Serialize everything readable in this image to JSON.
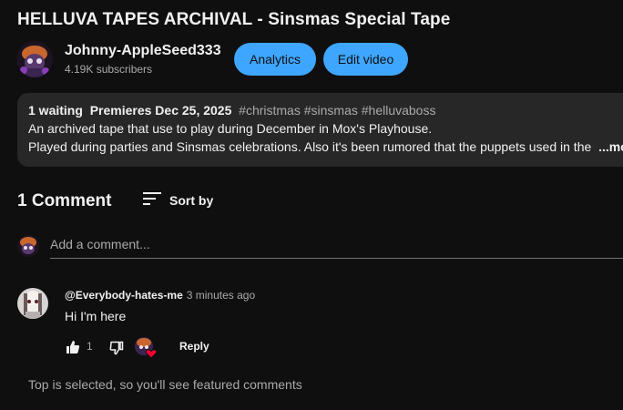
{
  "video": {
    "title": "HELLUVA TAPES ARCHIVAL - Sinsmas Special Tape"
  },
  "channel": {
    "name": "Johnny-AppleSeed333",
    "subscribers": "4.19K subscribers",
    "analytics_label": "Analytics",
    "edit_label": "Edit video"
  },
  "description": {
    "waiting": "1 waiting",
    "premiere": "Premieres Dec 25, 2025",
    "hashtags": "#christmas #sinsmas #helluvaboss",
    "line1": "An archived tape that use to play during December in Mox's Playhouse.",
    "line2": "Played during parties and Sinsmas celebrations. Also it's been rumored that the puppets used in the",
    "more": "...more"
  },
  "comments": {
    "count_label": "1 Comment",
    "sort_label": "Sort by",
    "add_placeholder": "Add a comment...",
    "items": [
      {
        "author": "@Everybody-hates-me",
        "time": "3 minutes ago",
        "text": "Hi I'm here",
        "likes": "1",
        "reply_label": "Reply"
      }
    ],
    "footer_note": "Top is selected, so you'll see featured comments"
  },
  "icons": {
    "like": "thumbs-up-icon",
    "dislike": "thumbs-down-icon",
    "sort": "sort-lines-icon",
    "creator_heart": "creator-heart-icon"
  },
  "colors": {
    "accent": "#3ea6ff",
    "background": "#0f0f0f",
    "panel": "#272727",
    "heart": "#ff0033"
  }
}
